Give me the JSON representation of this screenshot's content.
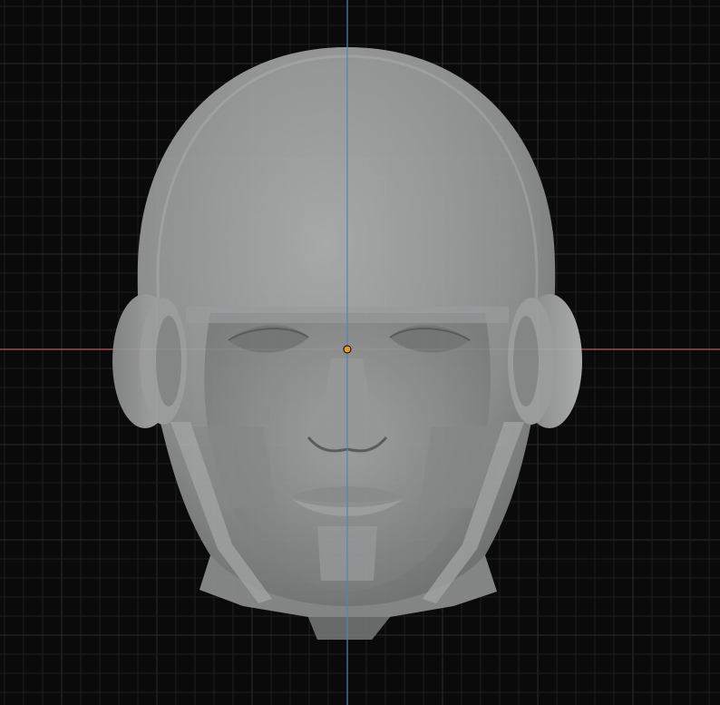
{
  "viewport": {
    "view": "front-orthographic",
    "background_color": "#0a0a0a",
    "grid": {
      "visible": true,
      "minor_color": "#1e1e1e",
      "major_color": "#2c2c2c"
    },
    "axes": {
      "x_axis_color": "#b85a66",
      "z_axis_color": "#4f86b8"
    },
    "origin_marker_color": "#e8962a",
    "object": {
      "name": "head-mesh",
      "display": "x-ray",
      "base_color": "#9a9d9d"
    }
  }
}
